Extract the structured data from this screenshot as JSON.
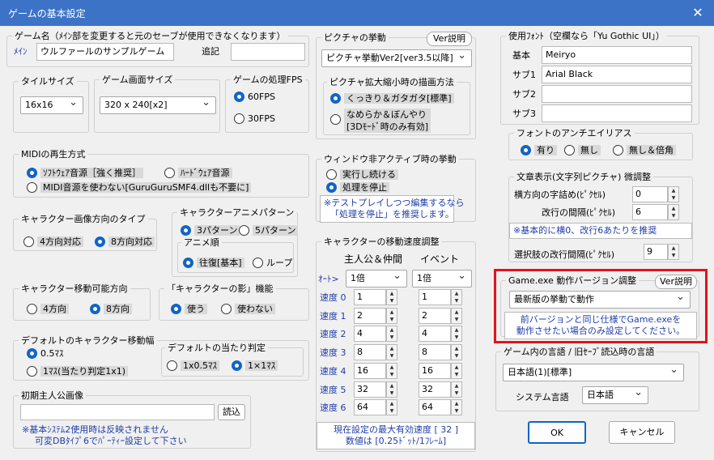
{
  "window": {
    "title": "ゲームの基本設定",
    "close_glyph": "✕"
  },
  "game_name": {
    "group": "ゲーム名（ﾒｲﾝ部を変更すると元のセーブが使用できなくなります）",
    "main_label": "ﾒｲﾝ",
    "main_value": "ウルファールのサンプルゲーム",
    "extra_label": "追記",
    "extra_value": ""
  },
  "tile_size": {
    "group": "タイルサイズ",
    "value": "16x16"
  },
  "screen_size": {
    "group": "ゲーム画面サイズ",
    "value": "320 x 240[x2]"
  },
  "fps": {
    "group": "ゲームの処理FPS",
    "opt1": "60FPS",
    "opt2": "30FPS"
  },
  "midi": {
    "group": "MIDIの再生方式",
    "opt1": "ｿﾌﾄｳｪｱ音源［強く推奨］",
    "opt2": "ﾊｰﾄﾞｳｪｱ音源",
    "opt3": "MIDI音源を使わない[GuruGuruSMF4.dllも不要に]"
  },
  "char_dir": {
    "group": "キャラクター画像方向のタイプ",
    "opt1": "4方向対応",
    "opt2": "8方向対応"
  },
  "char_anim": {
    "group": "キャラクターアニメパターン",
    "opt1": "3パターン",
    "opt2": "5パターン",
    "order_group": "アニメ順",
    "order1": "往復[基本]",
    "order2": "ループ"
  },
  "char_move_dir": {
    "group": "キャラクター移動可能方向",
    "opt1": "4方向",
    "opt2": "8方向"
  },
  "char_shadow": {
    "group": "「キャラクターの影」機能",
    "opt1": "使う",
    "opt2": "使わない"
  },
  "default_move": {
    "group": "デフォルトのキャラクター移動幅",
    "opt1": "0.5ﾏｽ",
    "opt2": "1ﾏｽ(当たり判定1x1)",
    "hit_group": "デフォルトの当たり判定",
    "hit1": "1x0.5ﾏｽ",
    "hit2": "1×1ﾏｽ"
  },
  "initial_hero": {
    "group": "初期主人公画像",
    "value": "",
    "load_button": "読込",
    "note1": "※基本ｼｽﾃﾑ2使用時は反映されません",
    "note2": "可変DBﾀｲﾌﾟ6でﾊﾟｰﾃｨｰ設定して下さい"
  },
  "picture": {
    "group": "ピクチャの挙動",
    "ver_button": "Ver説明",
    "value": "ピクチャ挙動Ver2[ver3.5以降]",
    "scale_group": "ピクチャ拡大縮小時の描画方法",
    "scale1": "くっきり＆ガタガタ[標準]",
    "scale2a": "なめらか＆ぼんやり",
    "scale2b": "[3Dﾓｰﾄﾞ時のみ有効]"
  },
  "inactive": {
    "group": "ウィンドウ非アクティブ時の挙動",
    "opt1": "実行し続ける",
    "opt2": "処理を停止",
    "note1": "※テストプレイしつつ編集するなら",
    "note2": "「処理を停止」を推奨します。"
  },
  "speed": {
    "group": "キャラクターの移動速度調整",
    "hero_header": "主人公＆仲間",
    "event_header": "イベント",
    "auto_label": "ｵｰﾄ>",
    "hero_auto": "1倍",
    "event_auto": "1倍",
    "rows": [
      {
        "label": "速度 0",
        "hero": "1",
        "event": "1"
      },
      {
        "label": "速度 1",
        "hero": "2",
        "event": "2"
      },
      {
        "label": "速度 2",
        "hero": "4",
        "event": "4"
      },
      {
        "label": "速度 3",
        "hero": "8",
        "event": "8"
      },
      {
        "label": "速度 4",
        "hero": "16",
        "event": "16"
      },
      {
        "label": "速度 5",
        "hero": "32",
        "event": "32"
      },
      {
        "label": "速度 6",
        "hero": "64",
        "event": "64"
      }
    ],
    "note1": "現在設定の最大有効速度 [ 32 ]",
    "note2": "数値は [0.25ﾄﾞｯﾄ/1ﾌﾚｰﾑ]"
  },
  "fonts": {
    "group": "使用ﾌｫﾝﾄ（空欄なら「Yu Gothic UI」）",
    "basic_label": "基本",
    "basic_value": "Meiryo",
    "sub1_label": "サブ1",
    "sub1_value": "Arial Black",
    "sub2_label": "サブ2",
    "sub2_value": "",
    "sub3_label": "サブ3",
    "sub3_value": ""
  },
  "antialias": {
    "group": "フォントのアンチエイリアス",
    "opt1": "有り",
    "opt2": "無し",
    "opt3": "無し＆倍角"
  },
  "text_display": {
    "group": "文章表示(文字列ピクチャ) 微調整",
    "hspace_label": "横方向の字詰め(ﾋﾟｸｾﾙ)",
    "hspace_value": "0",
    "linespace_label": "改行の間隔(ﾋﾟｸｾﾙ)",
    "linespace_value": "6",
    "note": "※基本的に横0、改行6あたりを推奨",
    "choice_label": "選択肢の改行間隔(ﾋﾟｸｾﾙ)",
    "choice_value": "9"
  },
  "exe_version": {
    "group": "Game.exe 動作バージョン調整",
    "ver_button": "Ver説明",
    "value": "最新版の挙動で動作",
    "note1": "前バージョンと同じ仕様でGame.exeを",
    "note2": "動作させたい場合のみ設定してください。"
  },
  "language": {
    "group": "ゲーム内の言語 / 旧ｾｰﾌﾞ読込時の言語",
    "value": "日本語(1)[標準]",
    "system_label": "システム言語",
    "system_value": "日本語"
  },
  "buttons": {
    "ok": "OK",
    "cancel": "キャンセル"
  }
}
